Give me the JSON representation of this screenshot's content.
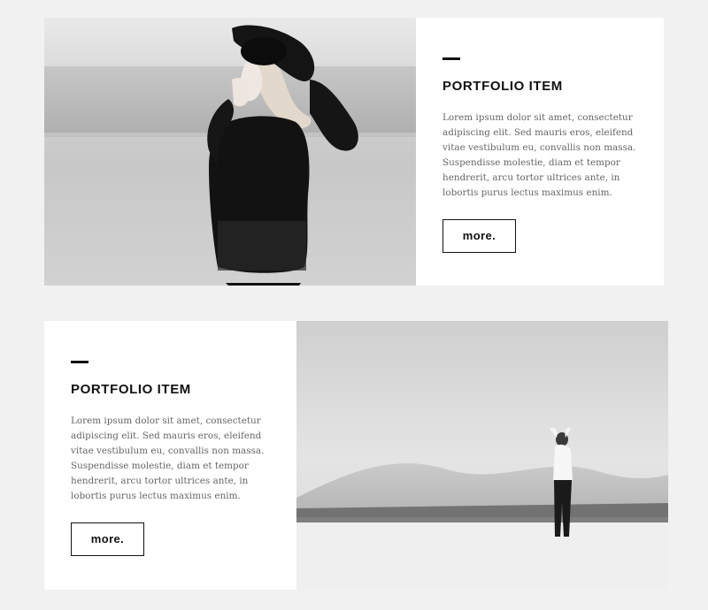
{
  "items": [
    {
      "title": "PORTFOLIO ITEM",
      "body": "Lorem ipsum dolor sit amet, consectetur adipiscing elit. Sed mauris eros, eleifend vitae vestibulum eu, convallis non massa. Suspendisse molestie, diam et tempor hendrerit, arcu tortor ultrices ante, in lobortis purus lectus maximus enim.",
      "button_label": "more."
    },
    {
      "title": "PORTFOLIO ITEM",
      "body": "Lorem ipsum dolor sit amet, consectetur adipiscing elit. Sed mauris eros, eleifend vitae vestibulum eu, convallis non massa. Suspendisse molestie, diam et tempor hendrerit, arcu tortor ultrices ante, in lobortis purus lectus maximus enim.",
      "button_label": "more."
    }
  ],
  "colors": {
    "page_background": "#f1f1f1",
    "card_background": "#ffffff",
    "title": "#111111",
    "body_text": "#666666",
    "button_border": "#111111"
  }
}
